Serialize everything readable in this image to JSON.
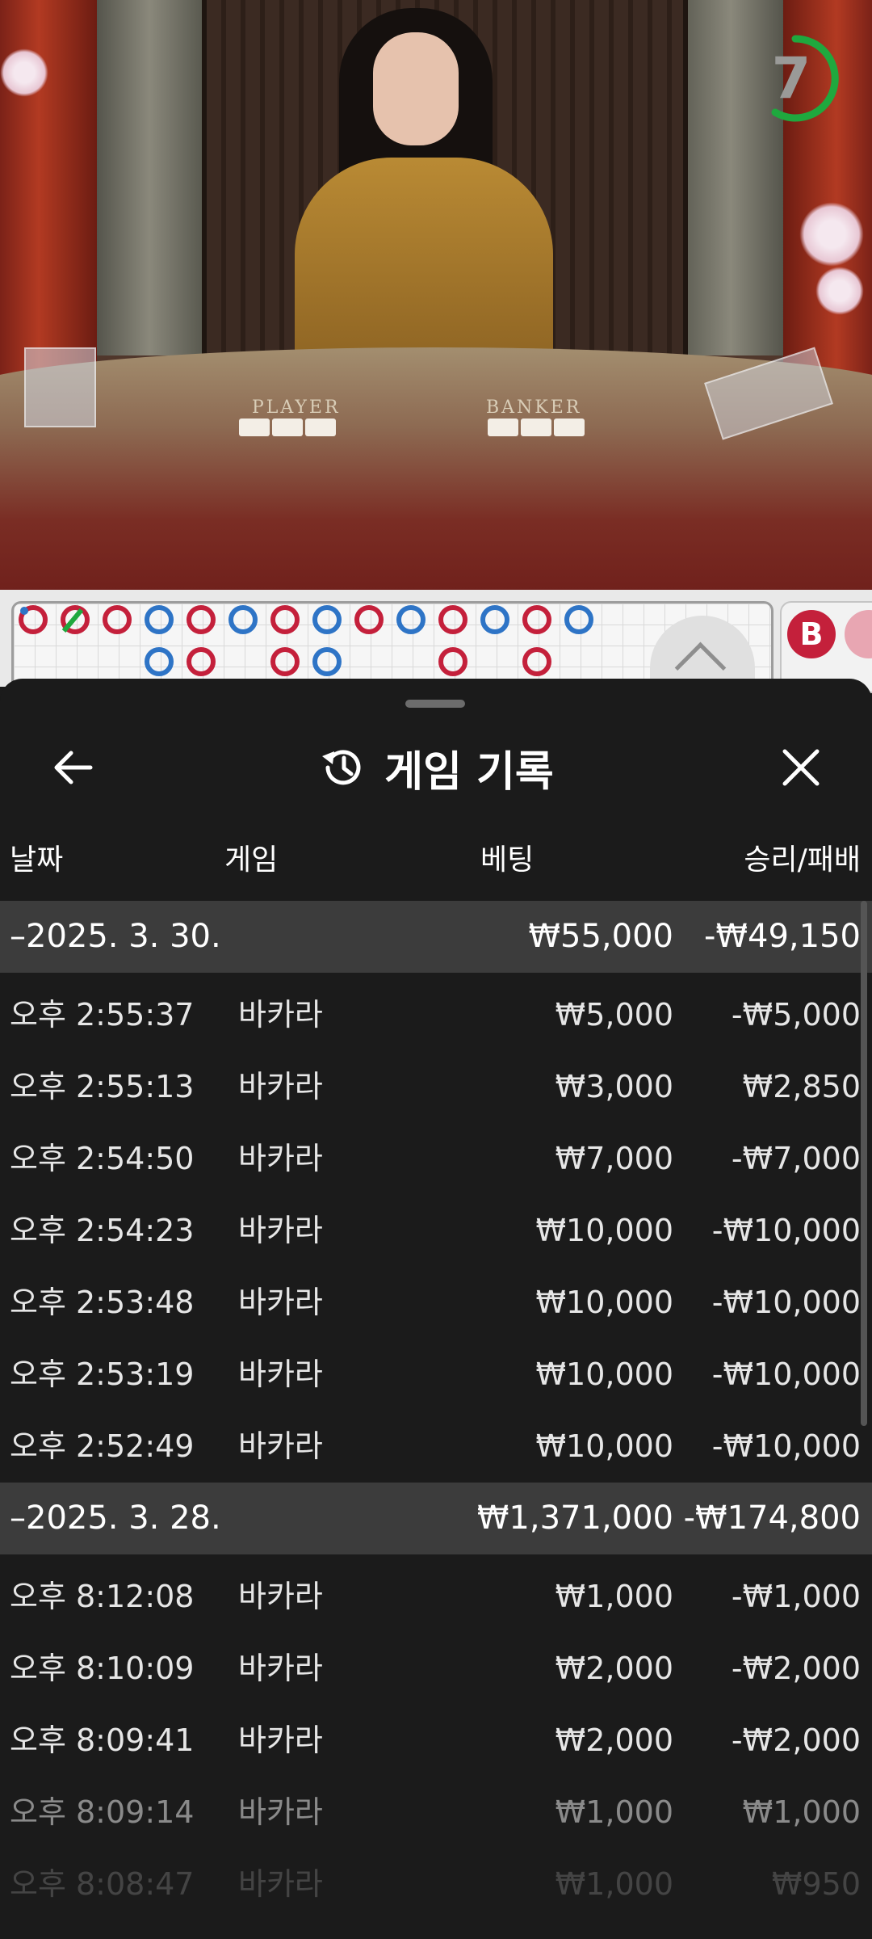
{
  "video": {
    "timer": "7",
    "table_labels": {
      "player": "PLAYER",
      "banker": "BANKER"
    },
    "colors": {
      "timer_ring": "#1fa83e"
    }
  },
  "roadmap": {
    "side_marker": "B",
    "colors": {
      "banker": "#c4203b",
      "player": "#2e74c6",
      "tie": "#1fa83e"
    },
    "expand_icon": "chevron-up-icon"
  },
  "sheet": {
    "title": "게임 기록",
    "icons": {
      "back": "arrow-left-icon",
      "title": "history-icon",
      "close": "close-icon"
    },
    "columns": {
      "date": "날짜",
      "game": "게임",
      "bet": "베팅",
      "result": "승리/패배"
    },
    "groups": [
      {
        "date": "–2025. 3. 30.",
        "bet": "₩55,000",
        "result": "-₩49,150",
        "items": [
          {
            "time": "오후 2:55:37",
            "game": "바카라",
            "bet": "₩5,000",
            "result": "-₩5,000"
          },
          {
            "time": "오후 2:55:13",
            "game": "바카라",
            "bet": "₩3,000",
            "result": "₩2,850"
          },
          {
            "time": "오후 2:54:50",
            "game": "바카라",
            "bet": "₩7,000",
            "result": "-₩7,000"
          },
          {
            "time": "오후 2:54:23",
            "game": "바카라",
            "bet": "₩10,000",
            "result": "-₩10,000"
          },
          {
            "time": "오후 2:53:48",
            "game": "바카라",
            "bet": "₩10,000",
            "result": "-₩10,000"
          },
          {
            "time": "오후 2:53:19",
            "game": "바카라",
            "bet": "₩10,000",
            "result": "-₩10,000"
          },
          {
            "time": "오후 2:52:49",
            "game": "바카라",
            "bet": "₩10,000",
            "result": "-₩10,000"
          }
        ]
      },
      {
        "date": "–2025. 3. 28.",
        "bet": "₩1,371,000",
        "result": "-₩174,800",
        "items": [
          {
            "time": "오후 8:12:08",
            "game": "바카라",
            "bet": "₩1,000",
            "result": "-₩1,000"
          },
          {
            "time": "오후 8:10:09",
            "game": "바카라",
            "bet": "₩2,000",
            "result": "-₩2,000"
          },
          {
            "time": "오후 8:09:41",
            "game": "바카라",
            "bet": "₩2,000",
            "result": "-₩2,000"
          },
          {
            "time": "오후 8:09:14",
            "game": "바카라",
            "bet": "₩1,000",
            "result": "₩1,000"
          },
          {
            "time": "오후 8:08:47",
            "game": "바카라",
            "bet": "₩1,000",
            "result": "₩950"
          }
        ]
      }
    ]
  }
}
